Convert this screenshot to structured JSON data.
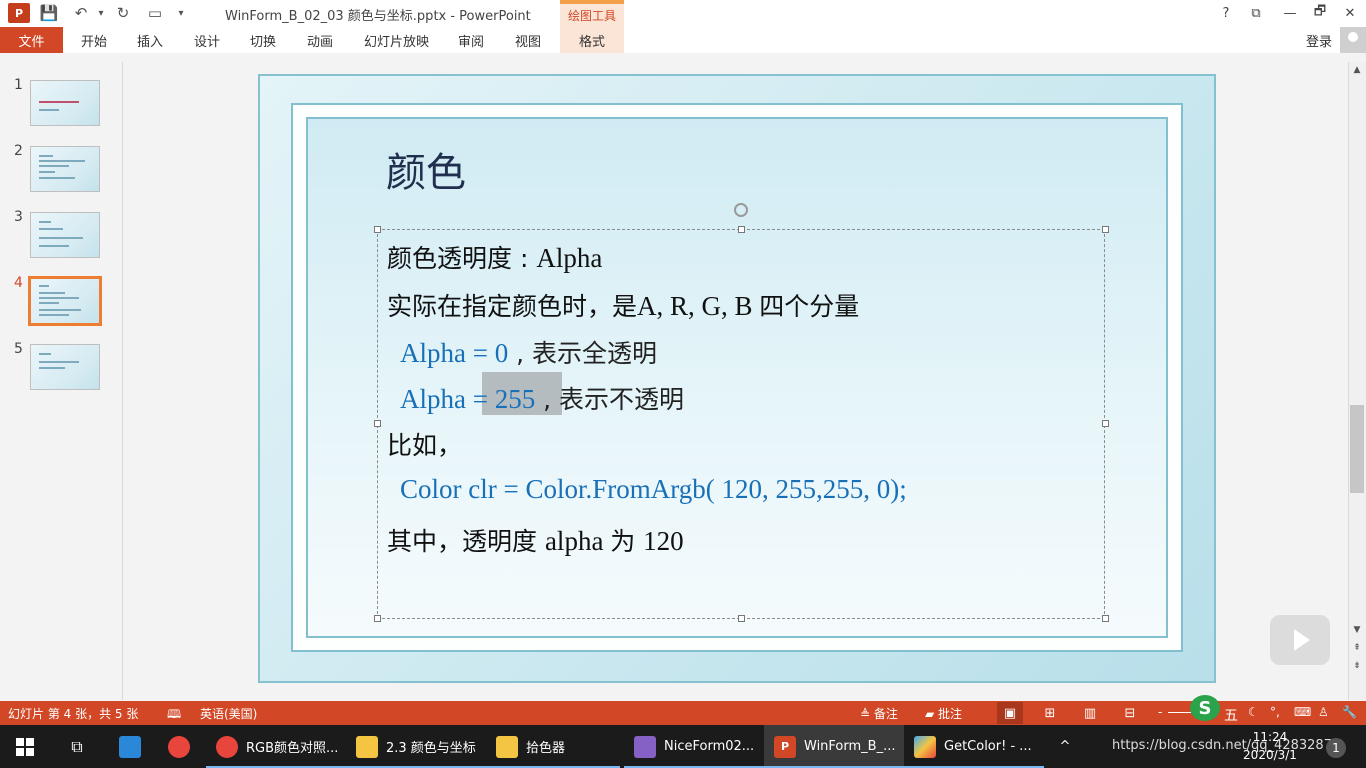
{
  "window": {
    "app_icon": "P",
    "title": "WinForm_B_02_03 颜色与坐标.pptx - PowerPoint",
    "context_tool": "绘图工具",
    "help": "?",
    "restore_ribbon": "⧉",
    "minimize": "—",
    "maximize": "🗗",
    "close": "✕"
  },
  "quick_access": {
    "save": "💾",
    "undo": "↶",
    "undo_more": "▾",
    "redo": "↻",
    "start_slideshow": "▭",
    "customize": "▾"
  },
  "ribbon": {
    "file_tab": "文件",
    "tabs": [
      "开始",
      "插入",
      "设计",
      "切换",
      "动画",
      "幻灯片放映",
      "审阅",
      "视图"
    ],
    "format_tab": "格式",
    "sign_in": "登录"
  },
  "thumbnails": [
    {
      "num": "1"
    },
    {
      "num": "2"
    },
    {
      "num": "3"
    },
    {
      "num": "4",
      "selected": true
    },
    {
      "num": "5"
    }
  ],
  "slide": {
    "title": "颜色",
    "lines": [
      {
        "zh1": "颜色透明度 : ",
        "en1": "Alpha"
      },
      {
        "zh1": "实际在指定颜色时，是",
        "en1": "A, R, G, B ",
        "zh2": "四个分量"
      },
      {
        "en1": "Alpha = 0",
        "zh1": " , 表示全透明"
      },
      {
        "en1": "Alpha = 255",
        "zh1": " , 表示不透明"
      },
      {
        "zh1": "比如，"
      },
      {
        "en1": "Color clr = Color.FromArgb( 120,  255,255, 0);"
      },
      {
        "zh1": "其中，透明度 ",
        "en1": "alpha ",
        "zh2": "为 ",
        "en2": "120"
      }
    ]
  },
  "statusbar": {
    "slide_info": "幻灯片 第 4 张，共 5 张",
    "language": "英语(美国)",
    "notes": "备注",
    "comments": "批注",
    "zoom_minus": "-",
    "zoom_plus": "+"
  },
  "taskbar": {
    "items": [
      {
        "label": "RGB颜色对照...",
        "icon": "chrome-icon",
        "color": "#e8453c"
      },
      {
        "label": "2.3 颜色与坐标",
        "icon": "folder-icon",
        "color": "#f4c542"
      },
      {
        "label": "拾色器",
        "icon": "folder-icon",
        "color": "#f4c542"
      },
      {
        "label": "NiceForm02...",
        "icon": "visual-studio-icon",
        "color": "#8661c5"
      },
      {
        "label": "WinForm_B_...",
        "icon": "powerpoint-icon",
        "color": "#d24726"
      },
      {
        "label": "GetColor! - ...",
        "icon": "color-app-icon",
        "color": "#3fa9f5"
      }
    ],
    "tray_text": "https://blog.csdn.net/qq_42832872",
    "time": "11:24",
    "date": "2020/3/1",
    "ime": "五"
  }
}
